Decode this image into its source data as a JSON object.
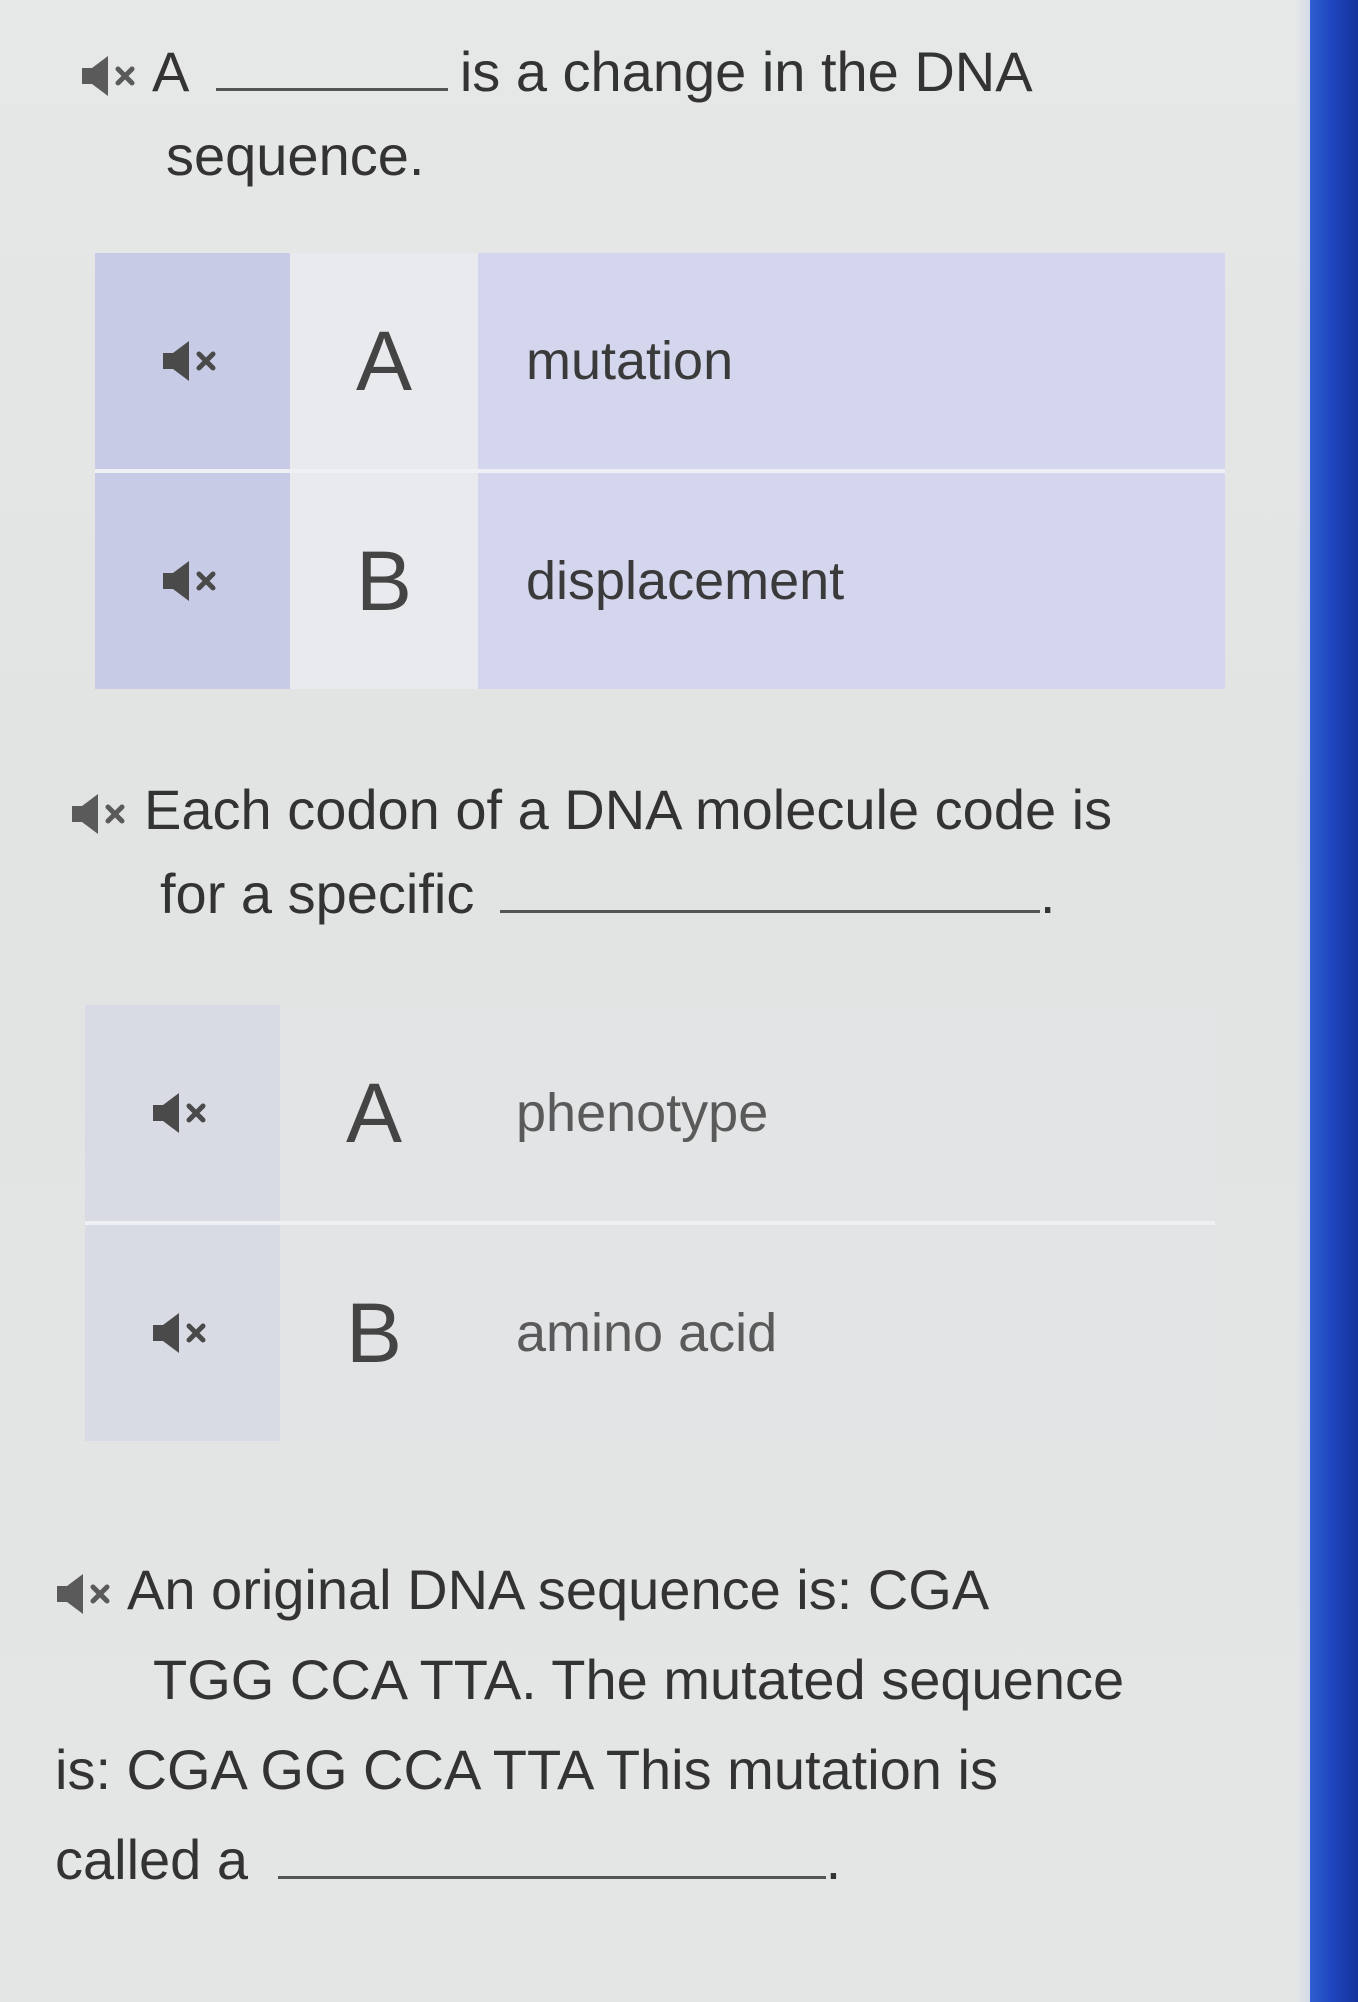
{
  "questions": [
    {
      "prefix": "A",
      "suffix": "is a change in the DNA",
      "line2": "sequence.",
      "options": [
        {
          "letter": "A",
          "text": "mutation"
        },
        {
          "letter": "B",
          "text": "displacement"
        }
      ]
    },
    {
      "line1": "Each codon of a DNA molecule code is",
      "line2_prefix": "for a specific",
      "line2_suffix": ".",
      "options": [
        {
          "letter": "A",
          "text": "phenotype"
        },
        {
          "letter": "B",
          "text": "amino acid"
        }
      ]
    },
    {
      "line1": "An original DNA sequence is: CGA",
      "line2": "TGG CCA TTA. The mutated sequence",
      "line3": "is: CGA GG CCA TTA This mutation is",
      "line4_prefix": "called a",
      "line4_suffix": "."
    }
  ],
  "icons": {
    "speaker": "speaker-muted-icon"
  },
  "colors": {
    "accent_bar": "#1f46c0",
    "q1_highlight": "#d4d6ee"
  }
}
